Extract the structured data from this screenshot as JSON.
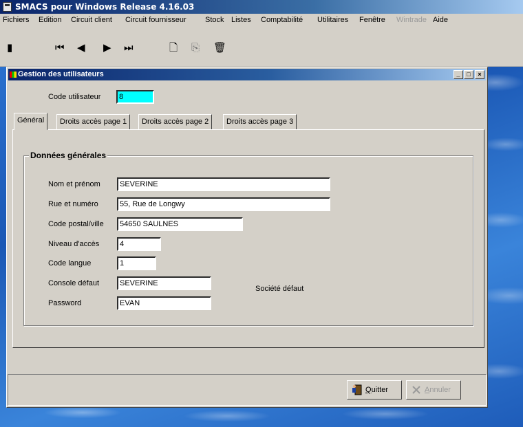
{
  "app": {
    "title": "SMACS pour Windows Release 4.16.03"
  },
  "menu": [
    "Fichiers",
    "Edition",
    "Circuit client",
    "Circuit fournisseur",
    "Stock",
    "Listes",
    "Comptabilité",
    "Utilitaires",
    "Fenêtre",
    "Wintrade",
    "Aide"
  ],
  "menu_disabled": [
    "Wintrade"
  ],
  "toolbar": [
    "exit-door-icon",
    "first-record-icon",
    "previous-record-icon",
    "next-record-icon",
    "last-record-icon",
    "new-document-icon",
    "copy-document-icon",
    "delete-trash-icon"
  ],
  "window": {
    "title": "Gestion des utilisateurs",
    "minimize_label": "_",
    "maximize_label": "□",
    "close_label": "×"
  },
  "code_utilisateur": {
    "label": "Code utilisateur",
    "value": "8"
  },
  "tabs": [
    "Général",
    "Droits accès page 1",
    "Droits accès page 2",
    "Droits accès page 3"
  ],
  "active_tab": "Général",
  "group": {
    "title": "Données générales",
    "fields": [
      {
        "label": "Nom et prénom",
        "value": "SEVERINE"
      },
      {
        "label": "Rue et numéro",
        "value": "55, Rue de Longwy"
      },
      {
        "label": "Code postal/ville",
        "value": "54650 SAULNES"
      },
      {
        "label": "Niveau d'accès",
        "value": "4"
      },
      {
        "label": "Code langue",
        "value": "1"
      },
      {
        "label": "Console défaut",
        "value": "SEVERINE"
      },
      {
        "label": "Password",
        "value": "EVAN"
      }
    ],
    "societe_label": "Société défaut"
  },
  "buttons": {
    "quit": {
      "accel": "Q",
      "rest": "uitter"
    },
    "cancel": {
      "accel": "A",
      "rest": "nnuler"
    }
  }
}
